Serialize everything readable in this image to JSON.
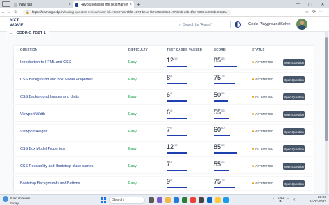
{
  "browser": {
    "tabs": [
      {
        "title": "New tab"
      },
      {
        "title": "Revolutionising the skill Market - ..."
      }
    ],
    "tab_close": "×",
    "new_tab": "+",
    "url_host": "https://learning.ccbp.in",
    "url_path": "/coding-question-review/exam-id=e7e527ab-5bf2-4274-bc1a-fb71069ab6c6=77d66b-dcb-4f0e-9008-a0068b469a2a",
    "window_controls": [
      "—",
      "▢",
      "✕"
    ],
    "toolbar_icons": [
      "☆",
      "⟳",
      "⋯"
    ]
  },
  "app": {
    "logo_line1": "NXT",
    "logo_line2": "WAVE",
    "search_placeholder": "Search for 'Arrays'",
    "code_playground": "Code Playground",
    "solve": "Solve",
    "breadcrumb_back": "←",
    "breadcrumb_title": "CODING TEST 1"
  },
  "table": {
    "headers": {
      "question": "QUESTION",
      "difficulty": "DIFFICULTY",
      "test_cases": "TEST CASES PASSED",
      "score": "SCORE",
      "status": "STATUS"
    },
    "rows": [
      {
        "question": "Introduction to HTML and CSS",
        "difficulty": "Easy",
        "passed": "12",
        "total": "/12",
        "score": "85",
        "max": "/85",
        "status": "ATTEMPTED",
        "action": "Open Question"
      },
      {
        "question": "CSS Background and Box Model Properties",
        "difficulty": "Easy",
        "passed": "8",
        "total": "/8",
        "score": "75",
        "max": "/75",
        "status": "ATTEMPTED",
        "action": "Open Question"
      },
      {
        "question": "CSS Background Images and Units",
        "difficulty": "Easy",
        "passed": "6",
        "total": "/6",
        "score": "50",
        "max": "/50",
        "status": "ATTEMPTED",
        "action": "Open Question"
      },
      {
        "question": "Viewport Width",
        "difficulty": "Easy",
        "passed": "6",
        "total": "/6",
        "score": "55",
        "max": "/55",
        "status": "ATTEMPTED",
        "action": "Open Question"
      },
      {
        "question": "Viewport Height",
        "difficulty": "Easy",
        "passed": "7",
        "total": "/7",
        "score": "60",
        "max": "/60",
        "status": "ATTEMPTED",
        "action": "Open Question"
      },
      {
        "question": "CSS Box Model Properties",
        "difficulty": "Easy",
        "passed": "12",
        "total": "/12",
        "score": "85",
        "max": "/85",
        "status": "ATTEMPTED",
        "action": "Open Question"
      },
      {
        "question": "CSS Reusability and Bootstrap class names",
        "difficulty": "Easy",
        "passed": "7",
        "total": "/7",
        "score": "55",
        "max": "/55",
        "status": "ATTEMPTED",
        "action": "Open Question"
      },
      {
        "question": "Bootstrap Backgrounds and Buttons",
        "difficulty": "Easy",
        "passed": "9",
        "total": "/9",
        "score": "75",
        "max": "/75",
        "status": "ATTEMPTED",
        "action": "Open Question"
      }
    ]
  },
  "taskbar": {
    "weather_line1": "Rain showers",
    "weather_line2": "Friday",
    "search_label": "Search",
    "lang_line1": "ENG",
    "lang_line2": "IN",
    "time": "23:26",
    "date": "24-02-2023"
  },
  "colors": {
    "accent": "#1e40af",
    "easy": "#16a34a",
    "attempted": "#f59e0b",
    "button": "#475569"
  }
}
